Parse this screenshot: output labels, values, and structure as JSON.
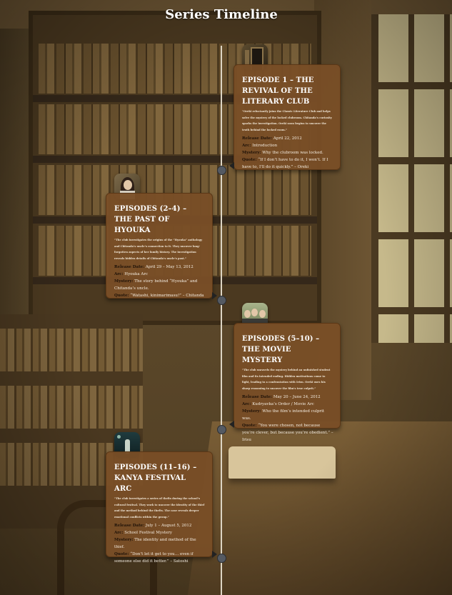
{
  "page": {
    "title": "Series Timeline"
  },
  "events": [
    {
      "heading": "EPISODE 1 – THE REVIVAL OF THE LITERARY CLUB",
      "description": "“Oreki reluctantly joins the Classic Literature Club and helps solve the mystery of the locked clubroom. Chitanda’s curiosity sparks the investigation. Oreki soon begins to uncover the truth behind the locked room.”",
      "release_label": "Release Date:",
      "release": "April 22, 2012",
      "arc_label": "Arc:",
      "arc": "Introduction",
      "mystery_label": "Mystery:",
      "mystery": "Why the clubroom was locked.",
      "quote_label": "Quote:",
      "quote": "“If I don’t have to do it, I won’t. If I have to, I’ll do it quickly.” – Oreki",
      "thumb_icon": "clubroom-door-icon",
      "side": "right"
    },
    {
      "heading": "EPISODES (2–4) – THE PAST OF HYOUKA",
      "description": "“The club investigates the origins of the “Hyouka” anthology and Chitanda’s uncle’s connection to it. They uncover long-forgotten aspects of her family history. The investigation reveals hidden details of Chitanda’s uncle’s past.”",
      "release_label": "Release Date:",
      "release": "April 29 – May 13, 2012",
      "arc_label": "Arc:",
      "arc": "Hyouka Arc",
      "mystery_label": "Mystery:",
      "mystery": "The story behind “Hyouka” and Chitanda’s uncle.",
      "quote_label": "Quote:",
      "quote": "“Watashi, kinimarimasu!” – Chitanda",
      "thumb_icon": "chitanda-portrait-icon",
      "side": "left"
    },
    {
      "heading": "EPISODES (5–10) – THE MOVIE MYSTERY",
      "description": "“The club unravels the mystery behind an unfinished student film and its intended ending. Hidden motivations come to light, leading to a confrontation with Irisu. Oreki uses his sharp reasoning to uncover the film’s true culprit.”",
      "release_label": "Release Date:",
      "release": "May 20 – June 24, 2012",
      "arc_label": "Arc:",
      "arc": "Kudryavka’s Order / Movie Arc",
      "mystery_label": "Mystery:",
      "mystery": "Who the film’s intended culprit was.",
      "quote_label": "Quote:",
      "quote": "“You were chosen, not because you’re clever, but because you’re obedient.” – Irisu",
      "thumb_icon": "club-members-group-icon",
      "side": "right"
    },
    {
      "heading": "EPISODES (11–16) – KANYA FESTIVAL ARC",
      "description": "“The club investigates a series of thefts during the school’s cultural festival. They work to uncover the identity of the thief and the method behind the thefts. The case reveals deeper emotional conflicts within the group.”",
      "release_label": "Release Date:",
      "release": "July 1 – August 5, 2012",
      "arc_label": "Arc:",
      "arc": "School Festival Mystery",
      "mystery_label": "Mystery:",
      "mystery": "The identity and method of the thief.",
      "quote_label": "Quote:",
      "quote": "“Don’t let it get to you… even if someone else did it better.” – Satoshi",
      "thumb_icon": "festival-night-scene-icon",
      "side": "left"
    }
  ]
}
